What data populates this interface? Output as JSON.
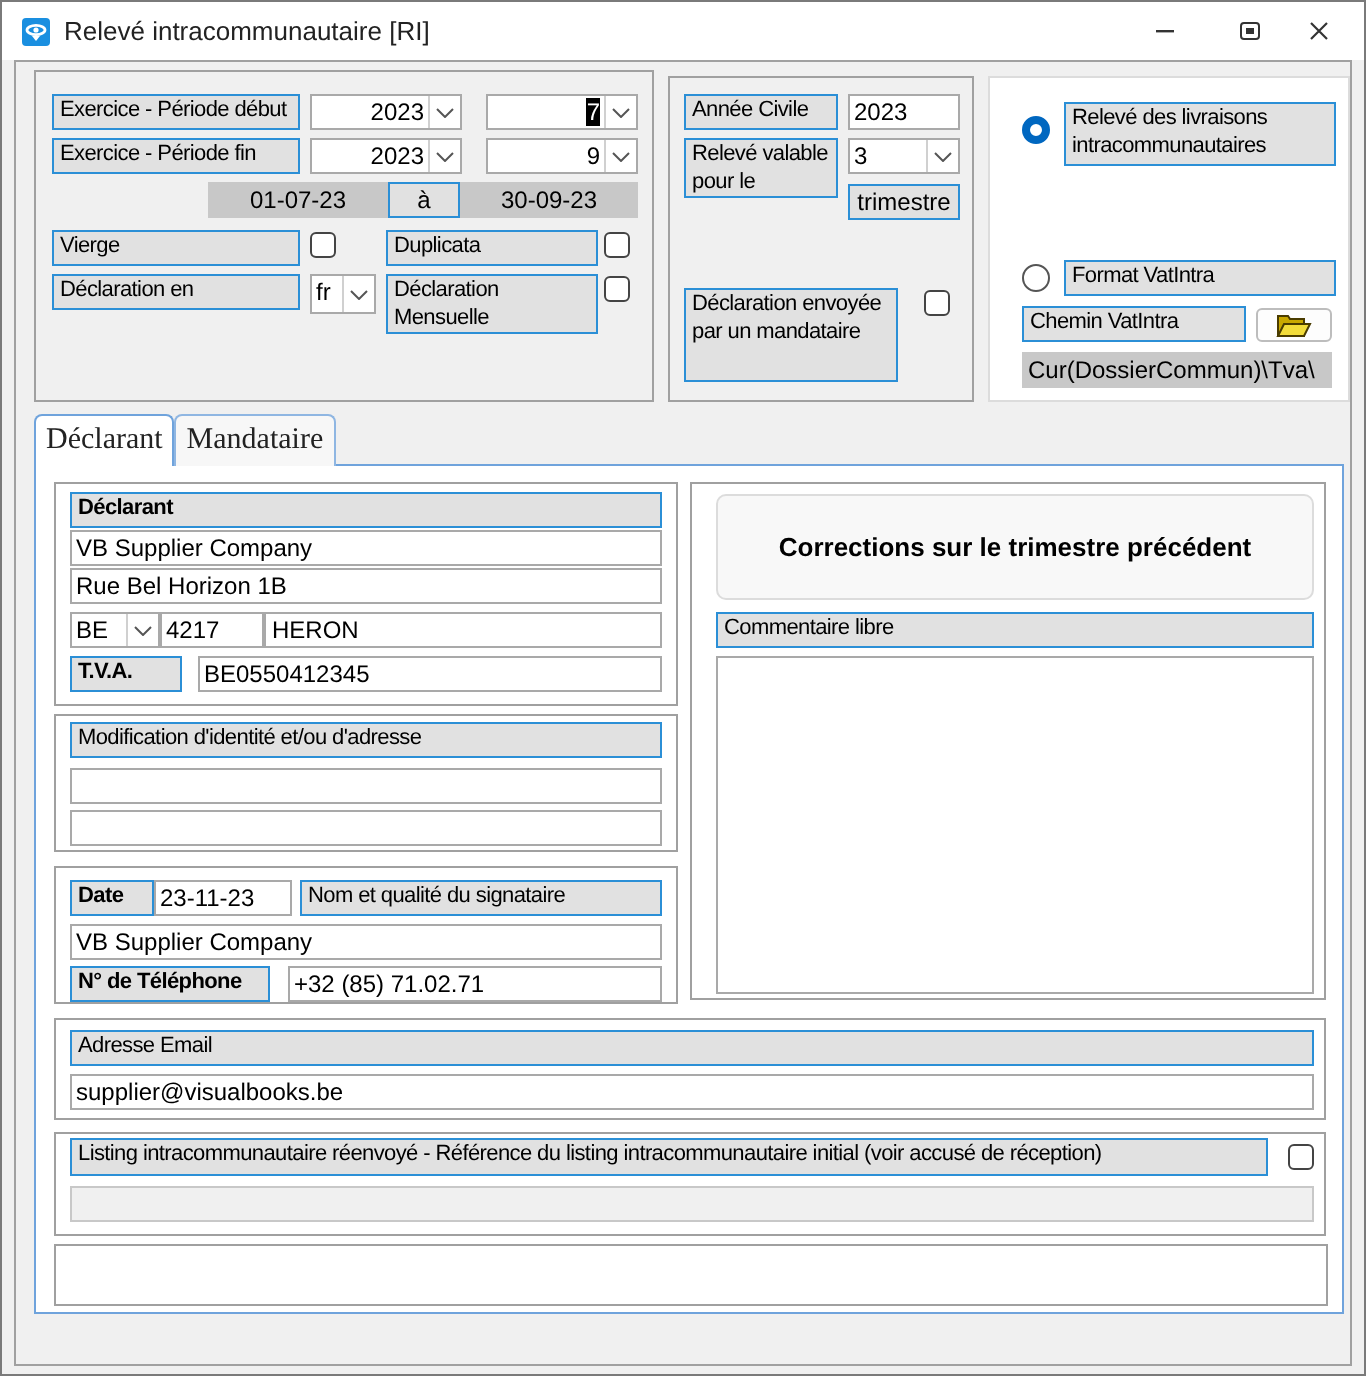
{
  "window": {
    "title": "Relevé intracommunautaire [RI]"
  },
  "period": {
    "start_label": "Exercice - Période début",
    "start_year": "2023",
    "start_period": "7",
    "start_period_highlighted": true,
    "end_label": "Exercice - Période fin",
    "end_year": "2023",
    "end_period": "9",
    "date_from": "01-07-23",
    "separator": "à",
    "date_to": "30-09-23"
  },
  "options": {
    "blank": {
      "label": "Vierge",
      "checked": false
    },
    "duplicate": {
      "label": "Duplicata",
      "checked": false
    },
    "language": {
      "label": "Déclaration en",
      "value": "fr"
    },
    "monthly": {
      "label": "Déclaration Mensuelle",
      "checked": false
    }
  },
  "civil_year": {
    "label": "Année Civile",
    "value": "2023"
  },
  "quarter": {
    "label": "Relevé valable pour le",
    "value": "3",
    "unit": "trimestre"
  },
  "agent": {
    "label": "Déclaration envoyée par un mandataire",
    "checked": false
  },
  "format": [
    {
      "label": "Relevé des livraisons intracommunautaires",
      "selected": true
    },
    {
      "label": "Format VatIntra",
      "selected": false
    }
  ],
  "path": {
    "label": "Chemin VatIntra",
    "value": "Cur(DossierCommun)\\Tva\\"
  },
  "tabs": [
    {
      "label": "Déclarant",
      "selected": true
    },
    {
      "label": "Mandataire",
      "selected": false
    }
  ],
  "declarant": {
    "heading": "Déclarant",
    "name": "VB Supplier Company",
    "street": "Rue Bel Horizon 1B",
    "country": "BE",
    "postcode": "4217",
    "city": "HERON",
    "vat_label": "T.V.A.",
    "vat": "BE0550412345"
  },
  "modification": {
    "heading": "Modification d'identité et/ou d'adresse"
  },
  "signature": {
    "date_label": "Date",
    "date": "23-11-23",
    "signatory_label": "Nom et qualité du signataire",
    "signatory": "VB Supplier Company",
    "phone_label": "N° de Téléphone",
    "phone": "+32 (85) 71.02.71"
  },
  "corrections": {
    "title": "Corrections sur le trimestre précédent",
    "comment_label": "Commentaire libre"
  },
  "email": {
    "label": "Adresse Email",
    "value": "supplier@visualbooks.be"
  },
  "resent": {
    "label": "Listing intracommunautaire réenvoyé - Référence du listing intracommunautaire initial (voir accusé de réception)",
    "checked": false
  }
}
